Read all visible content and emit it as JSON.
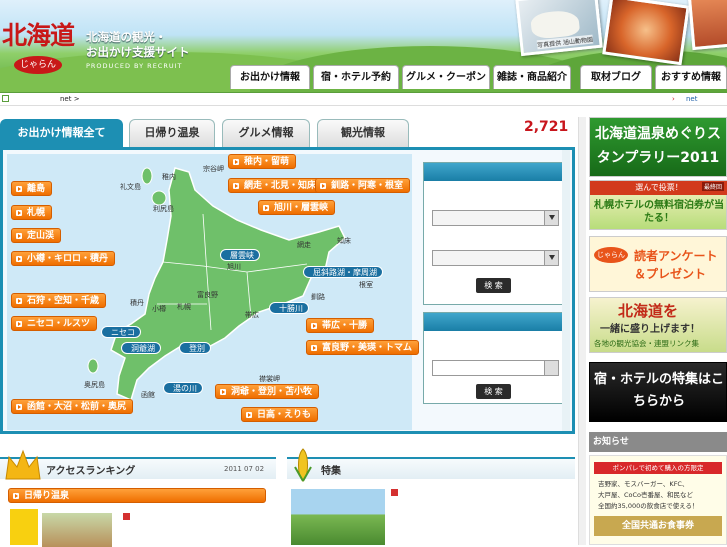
{
  "header": {
    "logo": "北海道",
    "logo_sub": "じゃらん",
    "tagline_1": "北海道の観光・",
    "tagline_2": "お出かけ支援サイト",
    "produced": "PRODUCED BY RECRUIT",
    "photo_caption": "写真提供 旭山動物園",
    "nav": [
      "お出かけ情報",
      "宿・ホテル予約",
      "グルメ・クーポン",
      "雑誌・商品紹介",
      "取材ブログ",
      "おすすめ情報"
    ]
  },
  "breadcrumb": {
    "left": "net  >",
    "right": "net"
  },
  "tabs": [
    "お出かけ情報全て",
    "日帰り温泉",
    "グルメ情報",
    "観光情報"
  ],
  "count": "2,721",
  "map": {
    "left_buttons": [
      "離島",
      "札幌",
      "定山渓",
      "小樽・キロロ・積丹",
      "石狩・空知・千歳",
      "ニセコ・ルスツ",
      "函館・大沼・松前・奥尻"
    ],
    "top_buttons": [
      "稚内・留萌",
      "網走・北見・知床",
      "釧路・阿寒・根室",
      "旭川・層雲峡"
    ],
    "bottom_buttons": [
      "帯広・十勝",
      "富良野・美瑛・トマム",
      "洞爺・登別・苫小牧",
      "日高・えりも"
    ],
    "pins": [
      "層雲峡",
      "屈斜路湖・摩周湖",
      "十勝川",
      "ニセコ",
      "洞爺湖",
      "登別",
      "湯の川"
    ],
    "place_labels": [
      "宗谷岬",
      "稚内",
      "礼文島",
      "利尻島",
      "知床",
      "網走",
      "根室",
      "釧路",
      "旭川",
      "富良野",
      "帯広",
      "積丹",
      "小樽",
      "札幌",
      "函館",
      "奥尻島",
      "襟裳岬"
    ]
  },
  "search": {
    "button": "検 索"
  },
  "ranking": {
    "title": "アクセスランキング",
    "date": "2011 07 02",
    "item": "日帰り温泉"
  },
  "feature": {
    "title": "特集"
  },
  "right": {
    "ad1": "北海道温泉めぐりスタンプラリー2011",
    "ad2_top": "選んで投票！",
    "ad2_badge": "最終回",
    "ad2_main": "札幌ホテルの無料宿泊券が当たる！",
    "ad3": "読者アンケート＆プレゼント",
    "ad3_logo": "じゃらん",
    "ad4_title": "北海道を",
    "ad4_sub": "一緒に盛り上げます！",
    "ad4_foot": "各地の観光協会・連盟リンク集",
    "ad5": "宿・ホテルの特集はこちらから",
    "news_title": "お知らせ",
    "news_line1": "ポンパレで初めて購入の方限定",
    "news_line2": "吉野家、モスバーガー、KFC、",
    "news_line3": "大戸屋、CoCo壱番屋、和民など",
    "news_line4": "全国約35,000の飲食店で使える！",
    "news_line5": "全国共通お食事券"
  },
  "colors": {
    "accent": "#1d8fb3",
    "orange": "#f07a10",
    "red": "#c8161d",
    "green": "#5aa83a"
  }
}
